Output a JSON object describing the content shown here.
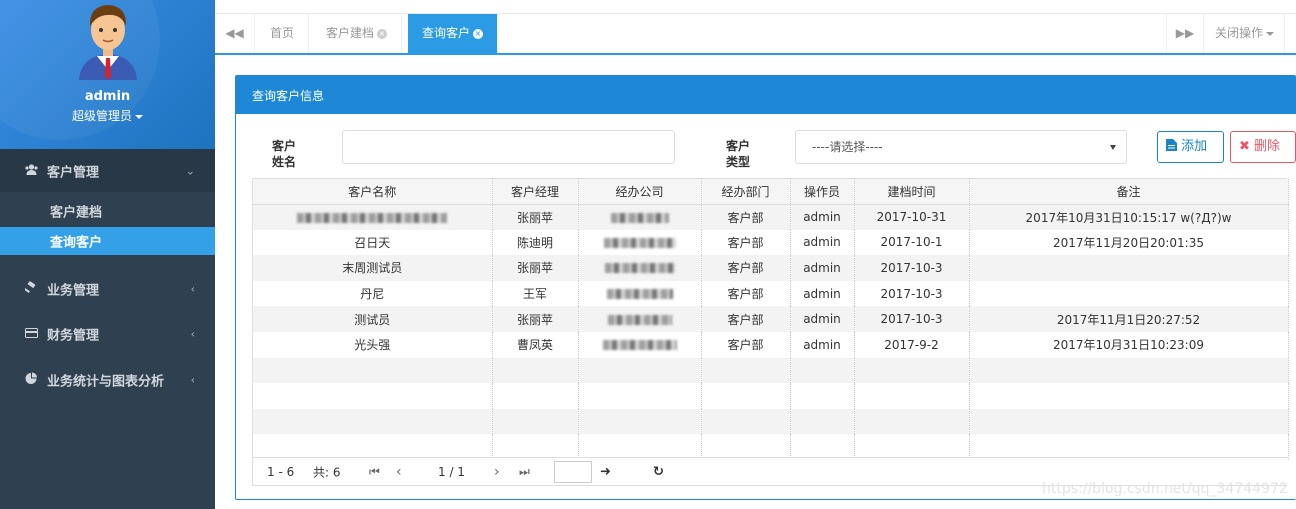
{
  "sidebar": {
    "user_name": "admin",
    "user_role": "超级管理员",
    "groups": [
      {
        "label": "客户管理",
        "icon": "users-icon"
      },
      {
        "label": "业务管理",
        "icon": "gavel-icon"
      },
      {
        "label": "财务管理",
        "icon": "credit-card-icon"
      },
      {
        "label": "业务统计与图表分析",
        "icon": "pie-chart-icon"
      }
    ],
    "subitems": [
      {
        "label": "客户建档"
      },
      {
        "label": "查询客户"
      }
    ]
  },
  "tabs": {
    "items": [
      {
        "label": "首页"
      },
      {
        "label": "客户建档"
      },
      {
        "label": "查询客户"
      }
    ],
    "close_ops": "关闭操作"
  },
  "panel": {
    "title": "查询客户信息",
    "name_label_1": "客户",
    "name_label_2": "姓名",
    "type_label_1": "客户",
    "type_label_2": "类型",
    "type_select": "----请选择----",
    "add_button": "添加",
    "delete_button": "删除"
  },
  "table": {
    "headers": [
      "客户名称",
      "客户经理",
      "经办公司",
      "经办部门",
      "操作员",
      "建档时间",
      "备注"
    ],
    "rows": [
      {
        "name": "",
        "manager": "张丽苹",
        "dept": "客户部",
        "operator": "admin",
        "date": "2017-10-31",
        "note": "2017年10月31日10:15:17 w(?Д?)w"
      },
      {
        "name": "召日天",
        "manager": "陈迪明",
        "dept": "客户部",
        "operator": "admin",
        "date": "2017-10-1",
        "note": "2017年11月20日20:01:35"
      },
      {
        "name": "末周测试员",
        "manager": "张丽苹",
        "dept": "客户部",
        "operator": "admin",
        "date": "2017-10-3",
        "note": ""
      },
      {
        "name": "丹尼",
        "manager": "王军",
        "dept": "客户部",
        "operator": "admin",
        "date": "2017-10-3",
        "note": ""
      },
      {
        "name": "测试员",
        "manager": "张丽苹",
        "dept": "客户部",
        "operator": "admin",
        "date": "2017-10-3",
        "note": "2017年11月1日20:27:52"
      },
      {
        "name": "光头强",
        "manager": "曹凤英",
        "dept": "客户部",
        "operator": "admin",
        "date": "2017-9-2",
        "note": "2017年10月31日10:23:09"
      }
    ]
  },
  "pager": {
    "range": "1 - 6",
    "total": "共: 6",
    "page": "1 / 1"
  },
  "watermark": "https://blog.csdn.net/qq_34744972",
  "colors": {
    "accent": "#2b9be6",
    "sidebar": "#2f4050",
    "danger": "#ed5565"
  }
}
